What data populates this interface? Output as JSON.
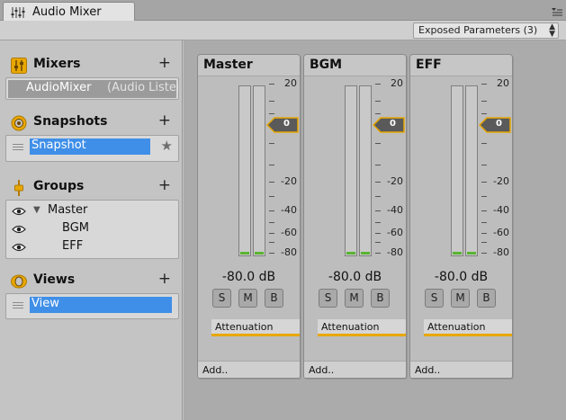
{
  "window": {
    "tab_title": "Audio Mixer"
  },
  "toolbar": {
    "exposed_params": "Exposed Parameters (3)"
  },
  "sidebar": {
    "mixers": {
      "title": "Mixers",
      "plus": "+",
      "items": [
        {
          "name": "AudioMixer",
          "extra": "(Audio Listener)"
        }
      ]
    },
    "snapshots": {
      "title": "Snapshots",
      "plus": "+",
      "items": [
        {
          "name": "Snapshot",
          "star": "★"
        }
      ]
    },
    "groups": {
      "title": "Groups",
      "plus": "+",
      "items": [
        {
          "name": "Master",
          "arrow": "▼"
        },
        {
          "name": "BGM"
        },
        {
          "name": "EFF"
        }
      ]
    },
    "views": {
      "title": "Views",
      "plus": "+",
      "items": [
        {
          "name": "View"
        }
      ]
    }
  },
  "strips": [
    {
      "name": "Master",
      "fader_value": "0",
      "level": "-80.0 dB",
      "solo": "S",
      "mute": "M",
      "bypass": "B",
      "effect": "Attenuation",
      "add": "Add.."
    },
    {
      "name": "BGM",
      "fader_value": "0",
      "level": "-80.0 dB",
      "solo": "S",
      "mute": "M",
      "bypass": "B",
      "effect": "Attenuation",
      "add": "Add.."
    },
    {
      "name": "EFF",
      "fader_value": "0",
      "level": "-80.0 dB",
      "solo": "S",
      "mute": "M",
      "bypass": "B",
      "effect": "Attenuation",
      "add": "Add.."
    }
  ],
  "scale_labels": [
    "20",
    "0",
    "-20",
    "-40",
    "-60",
    "-80"
  ],
  "colors": {
    "selection": "#3f8fe8",
    "fader_accent": "#e8a700",
    "meter_green": "#59b431"
  }
}
